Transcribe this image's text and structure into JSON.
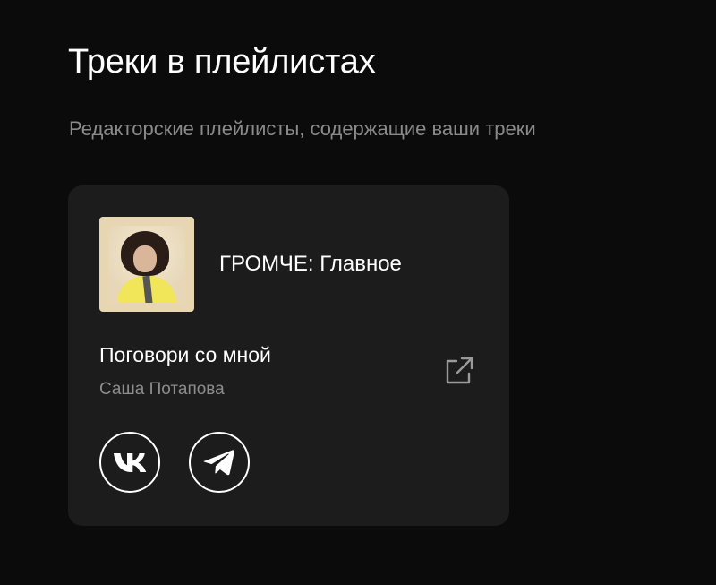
{
  "section": {
    "title": "Треки в плейлистах",
    "subtitle": "Редакторские плейлисты, содержащие ваши треки"
  },
  "card": {
    "playlist": {
      "name": "ГРОМЧЕ: Главное",
      "cover_icon": "playlist-cover-image"
    },
    "track": {
      "title": "Поговори со мной",
      "artist": "Саша Потапова"
    },
    "actions": {
      "open_external_icon": "external-link-icon"
    },
    "share": [
      {
        "icon": "vk-icon"
      },
      {
        "icon": "telegram-icon"
      }
    ]
  },
  "colors": {
    "background": "#0b0b0b",
    "card": "#1c1c1c",
    "text_primary": "#ffffff",
    "text_secondary": "#8a8a8a"
  }
}
